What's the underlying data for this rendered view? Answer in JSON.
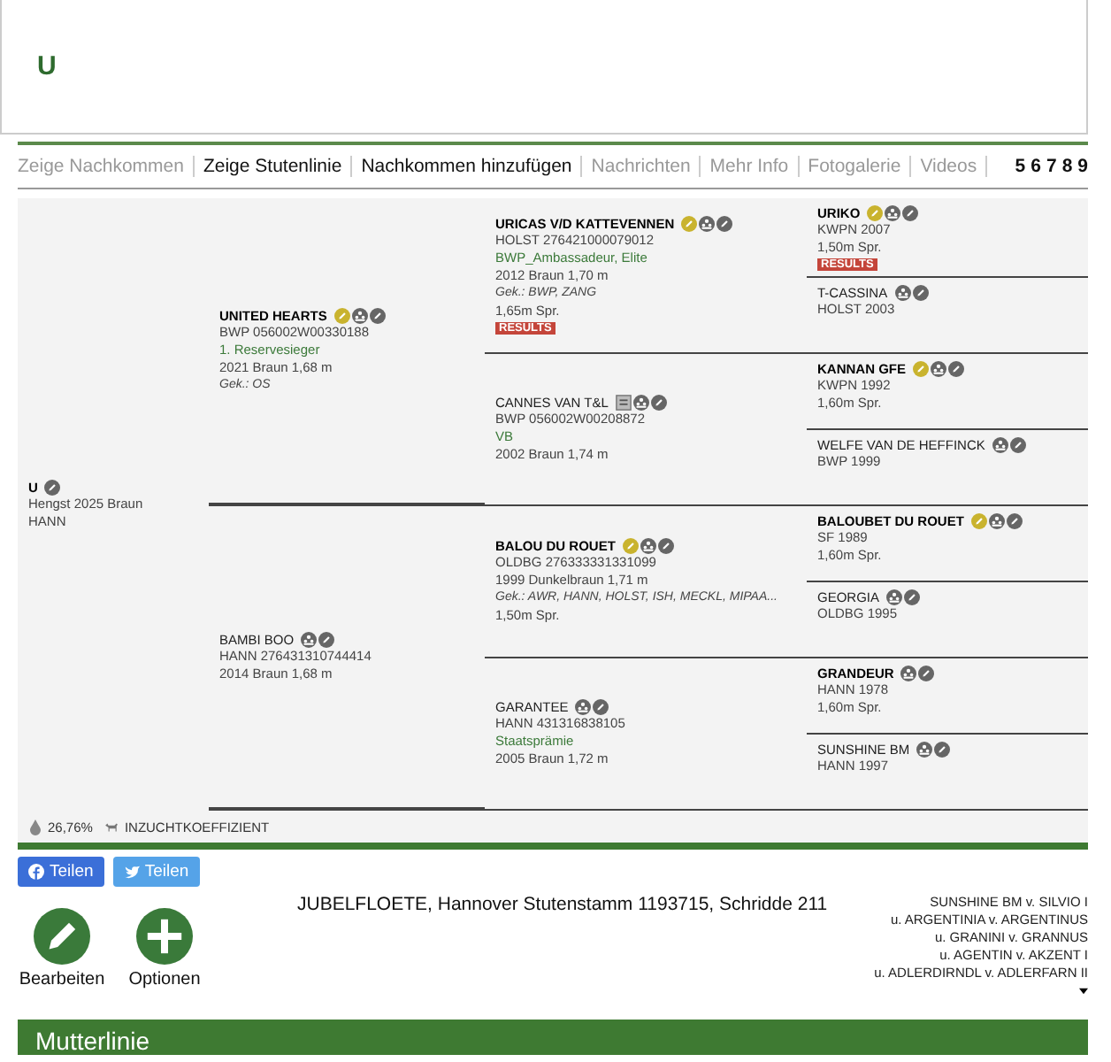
{
  "header": {
    "title": "U"
  },
  "nav": {
    "links": [
      {
        "label": "Zeige Nachkommen",
        "disabled": true
      },
      {
        "label": "Zeige Stutenlinie",
        "disabled": false
      },
      {
        "label": "Nachkommen hinzufügen",
        "disabled": false
      },
      {
        "label": "Nachrichten",
        "disabled": true
      },
      {
        "label": "Mehr Info",
        "disabled": true
      },
      {
        "label": "Fotogalerie",
        "disabled": true
      },
      {
        "label": "Videos",
        "disabled": true
      }
    ],
    "pages": [
      "5",
      "6",
      "7",
      "8",
      "9"
    ]
  },
  "pedigree": {
    "horse": {
      "name": "U",
      "bold": true,
      "badges": [
        {
          "kind": "edit"
        }
      ],
      "lines": [
        {
          "text": "Hengst 2025 Braun",
          "kind": "plain"
        },
        {
          "text": "HANN",
          "kind": "plain"
        }
      ],
      "parents": [
        {
          "name": "UNITED HEARTS",
          "bold": true,
          "badges": [
            {
              "kind": "star"
            },
            {
              "kind": "family"
            },
            {
              "kind": "edit"
            }
          ],
          "lines": [
            {
              "text": "BWP 056002W00330188",
              "kind": "plain"
            },
            {
              "text": "1. Reservesieger",
              "kind": "green"
            },
            {
              "text": "2021 Braun 1,68 m",
              "kind": "plain"
            },
            {
              "text": "Gek.: OS",
              "kind": "italic"
            }
          ],
          "parents": [
            {
              "name": "URICAS V/D KATTEVENNEN",
              "bold": true,
              "badges": [
                {
                  "kind": "star"
                },
                {
                  "kind": "family"
                },
                {
                  "kind": "edit"
                }
              ],
              "lines": [
                {
                  "text": "HOLST 276421000079012",
                  "kind": "plain"
                },
                {
                  "text": "BWP_Ambassadeur, Elite",
                  "kind": "green"
                },
                {
                  "text": "2012 Braun 1,70 m",
                  "kind": "plain"
                },
                {
                  "text": "Gek.: BWP, ZANG",
                  "kind": "italic"
                },
                {
                  "text": "1,65m Spr.",
                  "kind": "plain"
                },
                {
                  "text": "RESULTS",
                  "kind": "results"
                }
              ],
              "parents": [
                {
                  "name": "URIKO",
                  "bold": true,
                  "badges": [
                    {
                      "kind": "star"
                    },
                    {
                      "kind": "family"
                    },
                    {
                      "kind": "edit"
                    }
                  ],
                  "lines": [
                    {
                      "text": "KWPN 2007",
                      "kind": "plain"
                    },
                    {
                      "text": "1,50m Spr.",
                      "kind": "plain"
                    },
                    {
                      "text": "RESULTS",
                      "kind": "results"
                    }
                  ]
                },
                {
                  "name": "T-CASSINA",
                  "bold": false,
                  "badges": [
                    {
                      "kind": "family"
                    },
                    {
                      "kind": "edit"
                    }
                  ],
                  "lines": [
                    {
                      "text": "HOLST 2003",
                      "kind": "plain"
                    }
                  ]
                }
              ]
            },
            {
              "name": "CANNES VAN T&L",
              "bold": false,
              "badges": [
                {
                  "kind": "et"
                },
                {
                  "kind": "family"
                },
                {
                  "kind": "edit"
                }
              ],
              "lines": [
                {
                  "text": "BWP 056002W00208872",
                  "kind": "plain"
                },
                {
                  "text": "VB",
                  "kind": "green"
                },
                {
                  "text": "2002 Braun 1,74 m",
                  "kind": "plain"
                }
              ],
              "parents": [
                {
                  "name": "KANNAN GFE",
                  "bold": true,
                  "badges": [
                    {
                      "kind": "star"
                    },
                    {
                      "kind": "family"
                    },
                    {
                      "kind": "edit"
                    }
                  ],
                  "lines": [
                    {
                      "text": "KWPN 1992",
                      "kind": "plain"
                    },
                    {
                      "text": "1,60m Spr.",
                      "kind": "plain"
                    }
                  ]
                },
                {
                  "name": "WELFE VAN DE HEFFINCK",
                  "bold": false,
                  "badges": [
                    {
                      "kind": "family"
                    },
                    {
                      "kind": "edit"
                    }
                  ],
                  "lines": [
                    {
                      "text": "BWP 1999",
                      "kind": "plain"
                    }
                  ]
                }
              ]
            }
          ]
        },
        {
          "name": "BAMBI BOO",
          "bold": false,
          "badges": [
            {
              "kind": "family"
            },
            {
              "kind": "edit"
            }
          ],
          "lines": [
            {
              "text": "HANN 276431310744414",
              "kind": "plain"
            },
            {
              "text": "2014 Braun 1,68 m",
              "kind": "plain"
            }
          ],
          "parents": [
            {
              "name": "BALOU DU ROUET",
              "bold": true,
              "badges": [
                {
                  "kind": "star"
                },
                {
                  "kind": "family"
                },
                {
                  "kind": "edit"
                }
              ],
              "lines": [
                {
                  "text": "OLDBG 276333331331099",
                  "kind": "plain"
                },
                {
                  "text": "1999 Dunkelbraun 1,71 m",
                  "kind": "plain"
                },
                {
                  "text": "Gek.: AWR, HANN, HOLST, ISH, MECKL, MIPAA...",
                  "kind": "italic"
                },
                {
                  "text": "1,50m Spr.",
                  "kind": "plain"
                }
              ],
              "parents": [
                {
                  "name": "BALOUBET DU ROUET",
                  "bold": true,
                  "badges": [
                    {
                      "kind": "star"
                    },
                    {
                      "kind": "family"
                    },
                    {
                      "kind": "edit"
                    }
                  ],
                  "lines": [
                    {
                      "text": "SF 1989",
                      "kind": "plain"
                    },
                    {
                      "text": "1,60m Spr.",
                      "kind": "plain"
                    }
                  ]
                },
                {
                  "name": "GEORGIA",
                  "bold": false,
                  "badges": [
                    {
                      "kind": "family"
                    },
                    {
                      "kind": "edit"
                    }
                  ],
                  "lines": [
                    {
                      "text": "OLDBG 1995",
                      "kind": "plain"
                    }
                  ]
                }
              ]
            },
            {
              "name": "GARANTEE",
              "bold": false,
              "badges": [
                {
                  "kind": "family"
                },
                {
                  "kind": "edit"
                }
              ],
              "lines": [
                {
                  "text": "HANN 431316838105",
                  "kind": "plain"
                },
                {
                  "text": "Staatsprämie",
                  "kind": "green"
                },
                {
                  "text": "2005 Braun 1,72 m",
                  "kind": "plain"
                }
              ],
              "parents": [
                {
                  "name": "GRANDEUR",
                  "bold": true,
                  "badges": [
                    {
                      "kind": "family"
                    },
                    {
                      "kind": "edit"
                    }
                  ],
                  "lines": [
                    {
                      "text": "HANN 1978",
                      "kind": "plain"
                    },
                    {
                      "text": "1,60m Spr.",
                      "kind": "plain"
                    }
                  ]
                },
                {
                  "name": "SUNSHINE BM",
                  "bold": false,
                  "badges": [
                    {
                      "kind": "family"
                    },
                    {
                      "kind": "edit"
                    }
                  ],
                  "lines": [
                    {
                      "text": "HANN 1997",
                      "kind": "plain"
                    }
                  ]
                }
              ]
            }
          ]
        }
      ]
    },
    "inbreeding": {
      "value": "26,76%",
      "label": "INZUCHTKOEFFIZIENT"
    }
  },
  "share": [
    {
      "kind": "facebook",
      "label": "Teilen"
    },
    {
      "kind": "twitter",
      "label": "Teilen"
    }
  ],
  "actions": [
    {
      "kind": "edit",
      "label": "Bearbeiten"
    },
    {
      "kind": "add",
      "label": "Optionen"
    }
  ],
  "mare_line": "JUBELFLOETE, Hannover Stutenstamm 1193715, Schridde 211",
  "dam_line": [
    "SUNSHINE BM v. SILVIO I",
    "u. ARGENTINIA v. ARGENTINUS",
    "u. GRANINI v. GRANNUS",
    "u. AGENTIN v. AKZENT I",
    "u. ADLERDIRNDL v. ADLERFARN II"
  ],
  "section": {
    "title": "Mutterlinie"
  }
}
